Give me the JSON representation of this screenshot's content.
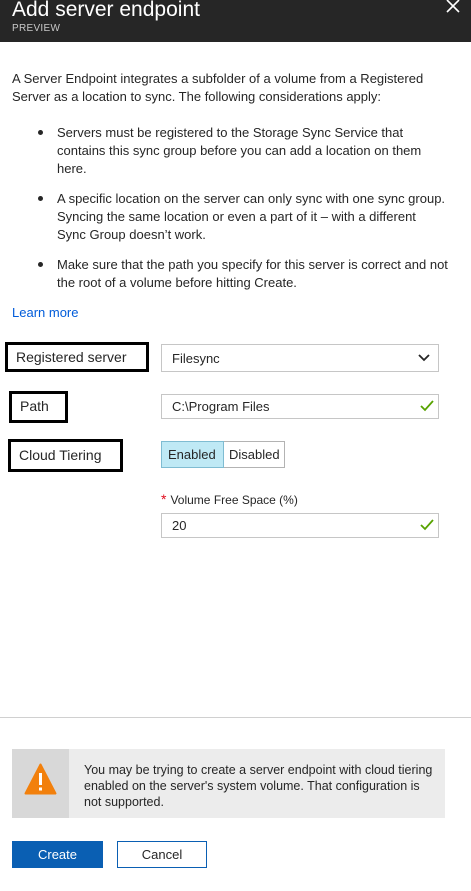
{
  "header": {
    "title": "Add server endpoint",
    "subtitle": "PREVIEW"
  },
  "intro": "A Server Endpoint integrates a subfolder of a volume from a Registered Server as a location to sync. The following considerations apply:",
  "considerations": [
    "Servers must be registered to the Storage Sync Service that contains this sync group before you can add a location on them here.",
    "A specific location on the server can only sync with one sync group. Syncing the same location or even a part of it – with a different Sync Group doesn’t work.",
    "Make sure that the path you specify for this server is correct and not the root of a volume before hitting Create."
  ],
  "learn_more": "Learn more",
  "form": {
    "registered_server": {
      "label": "Registered server",
      "value": "Filesync"
    },
    "path": {
      "label": "Path",
      "value": "C:\\Program Files"
    },
    "cloud_tiering": {
      "label": "Cloud Tiering",
      "enabled_label": "Enabled",
      "disabled_label": "Disabled",
      "selected": "Enabled"
    },
    "volume_free_space": {
      "required_mark": "*",
      "label": "Volume Free Space (%)",
      "value": "20"
    }
  },
  "warning": {
    "icon": "warning-triangle-icon",
    "text": "You may be trying to create a server endpoint with cloud tiering enabled on the server's system volume. That configuration is not supported."
  },
  "buttons": {
    "create": "Create",
    "cancel": "Cancel"
  },
  "colors": {
    "header_bg": "#262626",
    "accent": "#0a5fb3",
    "link": "#015cda",
    "toggle_selected": "#bfe9f5",
    "valid_check": "#57a300",
    "warning_icon": "#f2800c"
  }
}
